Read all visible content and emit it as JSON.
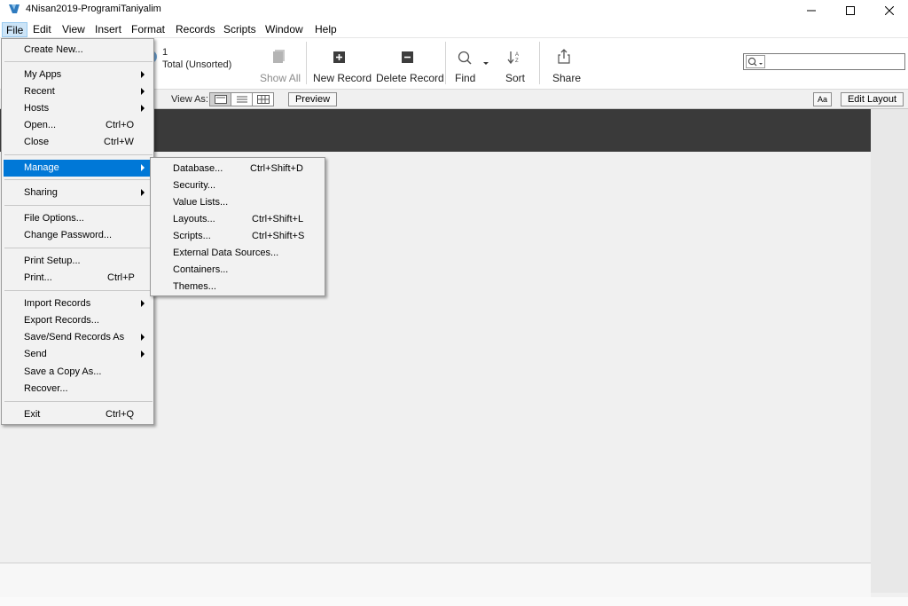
{
  "window": {
    "title": "4Nisan2019-ProgramiTaniyalim"
  },
  "menubar": [
    "File",
    "Edit",
    "View",
    "Insert",
    "Format",
    "Records",
    "Scripts",
    "Window",
    "Help"
  ],
  "toolbar": {
    "record_count": "1",
    "record_status": "Total (Unsorted)",
    "show_all": "Show All",
    "new_record": "New Record",
    "delete_record": "Delete Record",
    "find": "Find",
    "sort": "Sort",
    "share": "Share"
  },
  "layoutbar": {
    "view_as": "View As:",
    "preview": "Preview",
    "aa": "Aa",
    "edit_layout": "Edit Layout"
  },
  "file_menu": {
    "items": [
      {
        "label": "Create New...",
        "shortcut": ""
      },
      {
        "label": "My Apps",
        "shortcut": ""
      },
      {
        "label": "Recent",
        "shortcut": ""
      },
      {
        "label": "Hosts",
        "shortcut": ""
      },
      {
        "label": "Open...",
        "shortcut": "Ctrl+O"
      },
      {
        "label": "Close",
        "shortcut": "Ctrl+W"
      },
      {
        "label": "Manage",
        "shortcut": ""
      },
      {
        "label": "Sharing",
        "shortcut": ""
      },
      {
        "label": "File Options...",
        "shortcut": ""
      },
      {
        "label": "Change Password...",
        "shortcut": ""
      },
      {
        "label": "Print Setup...",
        "shortcut": ""
      },
      {
        "label": "Print...",
        "shortcut": "Ctrl+P"
      },
      {
        "label": "Import Records",
        "shortcut": ""
      },
      {
        "label": "Export Records...",
        "shortcut": ""
      },
      {
        "label": "Save/Send Records As",
        "shortcut": ""
      },
      {
        "label": "Send",
        "shortcut": ""
      },
      {
        "label": "Save a Copy As...",
        "shortcut": ""
      },
      {
        "label": "Recover...",
        "shortcut": ""
      },
      {
        "label": "Exit",
        "shortcut": "Ctrl+Q"
      }
    ]
  },
  "manage_menu": {
    "items": [
      {
        "label": "Database...",
        "shortcut": "Ctrl+Shift+D"
      },
      {
        "label": "Security...",
        "shortcut": ""
      },
      {
        "label": "Value Lists...",
        "shortcut": ""
      },
      {
        "label": "Layouts...",
        "shortcut": "Ctrl+Shift+L"
      },
      {
        "label": "Scripts...",
        "shortcut": "Ctrl+Shift+S"
      },
      {
        "label": "External Data Sources...",
        "shortcut": ""
      },
      {
        "label": "Containers...",
        "shortcut": ""
      },
      {
        "label": "Themes...",
        "shortcut": ""
      }
    ]
  }
}
